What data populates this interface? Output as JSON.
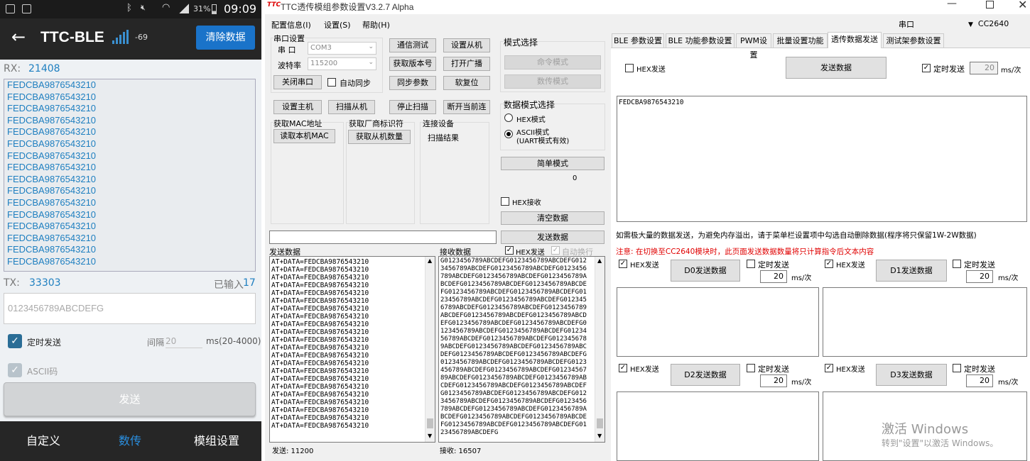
{
  "phone": {
    "status": {
      "percent": "31%",
      "time": "09:09"
    },
    "appbar": {
      "title": "TTC-BLE",
      "rssi": "-69",
      "clear_label": "清除数据"
    },
    "rx": {
      "label": "RX:",
      "count": "21408",
      "lines": [
        "FEDCBA9876543210",
        "FEDCBA9876543210",
        "FEDCBA9876543210",
        "FEDCBA9876543210",
        "FEDCBA9876543210",
        "FEDCBA9876543210",
        "FEDCBA9876543210",
        "FEDCBA9876543210",
        "FEDCBA9876543210",
        "FEDCBA9876543210",
        "FEDCBA9876543210",
        "FEDCBA9876543210",
        "FEDCBA9876543210",
        "FEDCBA9876543210",
        "FEDCBA9876543210",
        "FEDCBA9876543210"
      ]
    },
    "tx": {
      "label": "TX:",
      "count": "33303",
      "input_prefix": "已输入",
      "input_count": "17",
      "value": "0123456789ABCDEFG"
    },
    "timer": {
      "label": "定时发送",
      "interval_label": "间隔",
      "interval": "20",
      "unit": "ms(20-4000)"
    },
    "ascii_label": "ASCII码",
    "send_label": "发送",
    "nav": {
      "custom": "自定义",
      "data": "数传",
      "module": "模组设置"
    }
  },
  "win": {
    "title": "TTC透传模组参数设置V3.2.7 Alpha",
    "menu": [
      "配置信息(I)",
      "设置(S)",
      "帮助(H)"
    ],
    "port_label": "串口",
    "device": "CC2640",
    "serial": {
      "group": "串口设置",
      "port_label": "串  口",
      "port": "COM3",
      "baud_label": "波特率",
      "baud": "115200",
      "close_btn": "关闭串口",
      "autosync": "自动同步"
    },
    "buttons": {
      "comm_test": "通信测试",
      "set_slave": "设置从机",
      "get_version": "获取版本号",
      "open_broadcast": "打开广播",
      "sync_params": "同步参数",
      "soft_reset": "软复位",
      "set_master": "设置主机",
      "scan_slave": "扫描从机",
      "stop_scan": "停止扫描",
      "disconnect": "断开当前连"
    },
    "mac": {
      "group": "获取MAC地址",
      "btn": "读取本机MAC"
    },
    "vendor": {
      "group": "获取厂商标识符",
      "btn": "获取从机数量"
    },
    "connect": {
      "group": "连接设备",
      "result": "扫描结果"
    },
    "mode": {
      "group": "模式选择",
      "cmd": "命令模式",
      "data": "数传模式"
    },
    "datamode": {
      "group": "数据模式选择",
      "hex": "HEX模式",
      "ascii1": "ASCII模式",
      "ascii2": "(UART模式有效)"
    },
    "simple_btn": "简单模式",
    "counter": "0",
    "hex_recv": "HEX接收",
    "clear_btn": "清空数据",
    "send_btn": "发送数据",
    "send_label": "发送数据",
    "recv_label": "接收数据",
    "recv_hex": "HEX发送",
    "auto_wrap": "自动换行",
    "send_lines": [
      "AT+DATA=FEDCBA9876543210",
      "AT+DATA=FEDCBA9876543210",
      "AT+DATA=FEDCBA9876543210",
      "AT+DATA=FEDCBA9876543210",
      "AT+DATA=FEDCBA9876543210",
      "AT+DATA=FEDCBA9876543210",
      "AT+DATA=FEDCBA9876543210",
      "AT+DATA=FEDCBA9876543210",
      "AT+DATA=FEDCBA9876543210",
      "AT+DATA=FEDCBA9876543210",
      "AT+DATA=FEDCBA9876543210",
      "AT+DATA=FEDCBA9876543210",
      "AT+DATA=FEDCBA9876543210",
      "AT+DATA=FEDCBA9876543210",
      "AT+DATA=FEDCBA9876543210",
      "AT+DATA=FEDCBA9876543210",
      "AT+DATA=FEDCBA9876543210",
      "AT+DATA=FEDCBA9876543210",
      "AT+DATA=FEDCBA9876543210",
      "AT+DATA=FEDCBA9876543210",
      "AT+DATA=FEDCBA9876543210",
      "AT+DATA=FEDCBA9876543210"
    ],
    "recv_lines": [
      "G0123456789ABCDEFG0123456789ABCDEFG012",
      "3456789ABCDEFG0123456789ABCDEFG0123456",
      "789ABCDEFG0123456789ABCDEFG0123456789A",
      "BCDEFG0123456789ABCDEFG0123456789ABCDE",
      "FG0123456789ABCDEFG0123456789ABCDEFG01",
      "23456789ABCDEFG0123456789ABCDEFG012345",
      "6789ABCDEFG0123456789ABCDEFG0123456789",
      "ABCDEFG0123456789ABCDEFG0123456789ABCD",
      "EFG0123456789ABCDEFG0123456789ABCDEFG0",
      "123456789ABCDEFG0123456789ABCDEFG01234",
      "56789ABCDEFG0123456789ABCDEFG012345678",
      "9ABCDEFG0123456789ABCDEFG0123456789ABC",
      "DEFG0123456789ABCDEFG0123456789ABCDEFG",
      "0123456789ABCDEFG0123456789ABCDEFG0123",
      "456789ABCDEFG0123456789ABCDEFG01234567",
      "89ABCDEFG0123456789ABCDEFG0123456789AB",
      "CDEFG0123456789ABCDEFG0123456789ABCDEF",
      "G0123456789ABCDEFG0123456789ABCDEFG012",
      "3456789ABCDEFG0123456789ABCDEFG0123456",
      "789ABCDEFG0123456789ABCDEFG0123456789A",
      "BCDEFG0123456789ABCDEFG0123456789ABCDE",
      "FG0123456789ABCDEFG0123456789ABCDEFG01",
      "23456789ABCDEFG"
    ],
    "sent_count": "发送: 11200",
    "recv_count": "接收:  16507",
    "tabs": [
      "BLE 参数设置",
      "BLE 功能参数设置",
      "PWM设置",
      "批量设置功能",
      "透传数据发送",
      "测试架参数设置"
    ],
    "tp": {
      "hex_send": "HEX发送",
      "send_btn": "发送数据",
      "timed": "定时发送",
      "interval": "20",
      "unit": "ms/次",
      "content": "FEDCBA9876543210",
      "note": "如需极大量的数据发送，为避免内存溢出，请于菜单栏设置项中勾选自动删除数据(程序将只保留1W-2W数据)",
      "warning": "注意: 在切换至CC2640模块时，此页面发送数据数量将只计算指令后文本内容",
      "warn_color": "#e00000",
      "d0": "D0发送数据",
      "d1": "D1发送数据",
      "d2": "D2发送数据",
      "d3": "D3发送数据"
    },
    "watermark": {
      "line1": "激活 Windows",
      "line2": "转到\"设置\"以激活 Windows。"
    }
  }
}
